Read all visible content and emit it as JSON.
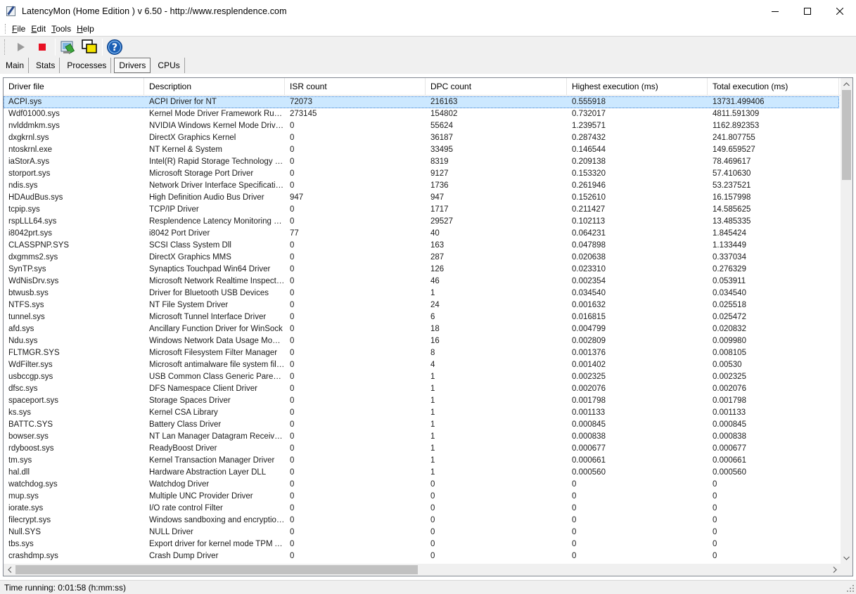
{
  "window": {
    "title": "LatencyMon  (Home Edition )  v 6.50 - http://www.resplendence.com"
  },
  "menu": [
    "File",
    "Edit",
    "Tools",
    "Help"
  ],
  "toolbar": {
    "icons": [
      "play-icon",
      "stop-icon",
      "report-icon",
      "windows-icon",
      "help-icon"
    ]
  },
  "tabs": [
    {
      "label": "Main",
      "active": false
    },
    {
      "label": "Stats",
      "active": false
    },
    {
      "label": "Processes",
      "active": false
    },
    {
      "label": "Drivers",
      "active": true
    },
    {
      "label": "CPUs",
      "active": false
    }
  ],
  "table": {
    "columns": [
      "Driver file",
      "Description",
      "ISR count",
      "DPC count",
      "Highest execution (ms)",
      "Total execution (ms)"
    ],
    "selected_row": 0,
    "rows": [
      [
        "ACPI.sys",
        "ACPI Driver for NT",
        "72073",
        "216163",
        "0.555918",
        "13731.499406"
      ],
      [
        "Wdf01000.sys",
        "Kernel Mode Driver Framework Runtime",
        "273145",
        "154802",
        "0.732017",
        "4811.591309"
      ],
      [
        "nvlddmkm.sys",
        "NVIDIA Windows Kernel Mode Driver, Version",
        "0",
        "55624",
        "1.239571",
        "1162.892353"
      ],
      [
        "dxgkrnl.sys",
        "DirectX Graphics Kernel",
        "0",
        "36187",
        "0.287432",
        "241.807755"
      ],
      [
        "ntoskrnl.exe",
        "NT Kernel & System",
        "0",
        "33495",
        "0.146544",
        "149.659527"
      ],
      [
        "iaStorA.sys",
        "Intel(R) Rapid Storage Technology driver",
        "0",
        "8319",
        "0.209138",
        "78.469617"
      ],
      [
        "storport.sys",
        "Microsoft Storage Port Driver",
        "0",
        "9127",
        "0.153320",
        "57.410630"
      ],
      [
        "ndis.sys",
        "Network Driver Interface Specification (NDIS)",
        "0",
        "1736",
        "0.261946",
        "53.237521"
      ],
      [
        "HDAudBus.sys",
        "High Definition Audio Bus Driver",
        "947",
        "947",
        "0.152610",
        "16.157998"
      ],
      [
        "tcpip.sys",
        "TCP/IP Driver",
        "0",
        "1717",
        "0.211427",
        "14.585625"
      ],
      [
        "rspLLL64.sys",
        "Resplendence Latency Monitoring and Auxiliary",
        "0",
        "29527",
        "0.102113",
        "13.485335"
      ],
      [
        "i8042prt.sys",
        "i8042 Port Driver",
        "77",
        "40",
        "0.064231",
        "1.845424"
      ],
      [
        "CLASSPNP.SYS",
        "SCSI Class System Dll",
        "0",
        "163",
        "0.047898",
        "1.133449"
      ],
      [
        "dxgmms2.sys",
        "DirectX Graphics MMS",
        "0",
        "287",
        "0.020638",
        "0.337034"
      ],
      [
        "SynTP.sys",
        "Synaptics Touchpad Win64 Driver",
        "0",
        "126",
        "0.023310",
        "0.276329"
      ],
      [
        "WdNisDrv.sys",
        "Microsoft Network Realtime Inspection Driver",
        "0",
        "46",
        "0.002354",
        "0.053911"
      ],
      [
        "btwusb.sys",
        "Driver for Bluetooth USB Devices",
        "0",
        "1",
        "0.034540",
        "0.034540"
      ],
      [
        "NTFS.sys",
        "NT File System Driver",
        "0",
        "24",
        "0.001632",
        "0.025518"
      ],
      [
        "tunnel.sys",
        "Microsoft Tunnel Interface Driver",
        "0",
        "6",
        "0.016815",
        "0.025472"
      ],
      [
        "afd.sys",
        "Ancillary Function Driver for WinSock",
        "0",
        "18",
        "0.004799",
        "0.020832"
      ],
      [
        "Ndu.sys",
        "Windows Network Data Usage Monitoring Driver",
        "0",
        "16",
        "0.002809",
        "0.009980"
      ],
      [
        "FLTMGR.SYS",
        "Microsoft Filesystem Filter Manager",
        "0",
        "8",
        "0.001376",
        "0.008105"
      ],
      [
        "WdFilter.sys",
        "Microsoft antimalware file system filter driver",
        "0",
        "4",
        "0.001402",
        "0.00530"
      ],
      [
        "usbccgp.sys",
        "USB Common Class Generic Parent Driver",
        "0",
        "1",
        "0.002325",
        "0.002325"
      ],
      [
        "dfsc.sys",
        "DFS Namespace Client Driver",
        "0",
        "1",
        "0.002076",
        "0.002076"
      ],
      [
        "spaceport.sys",
        "Storage Spaces Driver",
        "0",
        "1",
        "0.001798",
        "0.001798"
      ],
      [
        "ks.sys",
        "Kernel CSA Library",
        "0",
        "1",
        "0.001133",
        "0.001133"
      ],
      [
        "BATTC.SYS",
        "Battery Class Driver",
        "0",
        "1",
        "0.000845",
        "0.000845"
      ],
      [
        "bowser.sys",
        "NT Lan Manager Datagram Receiver Driver",
        "0",
        "1",
        "0.000838",
        "0.000838"
      ],
      [
        "rdyboost.sys",
        "ReadyBoost Driver",
        "0",
        "1",
        "0.000677",
        "0.000677"
      ],
      [
        "tm.sys",
        "Kernel Transaction Manager Driver",
        "0",
        "1",
        "0.000661",
        "0.000661"
      ],
      [
        "hal.dll",
        "Hardware Abstraction Layer DLL",
        "0",
        "1",
        "0.000560",
        "0.000560"
      ],
      [
        "watchdog.sys",
        "Watchdog Driver",
        "0",
        "0",
        "0",
        "0"
      ],
      [
        "mup.sys",
        "Multiple UNC Provider Driver",
        "0",
        "0",
        "0",
        "0"
      ],
      [
        "iorate.sys",
        "I/O rate control Filter",
        "0",
        "0",
        "0",
        "0"
      ],
      [
        "filecrypt.sys",
        "Windows sandboxing and encryption Filter",
        "0",
        "0",
        "0",
        "0"
      ],
      [
        "Null.SYS",
        "NULL Driver",
        "0",
        "0",
        "0",
        "0"
      ],
      [
        "tbs.sys",
        "Export driver for kernel mode TPM API",
        "0",
        "0",
        "0",
        "0"
      ],
      [
        "crashdmp.sys",
        "Crash Dump Driver",
        "0",
        "0",
        "0",
        "0"
      ]
    ]
  },
  "status": {
    "text": "Time running: 0:01:58  (h:mm:ss)"
  },
  "colors": {
    "selection": "#cce8ff",
    "stop_red": "#e81123",
    "help_blue": "#1b5fb5"
  }
}
